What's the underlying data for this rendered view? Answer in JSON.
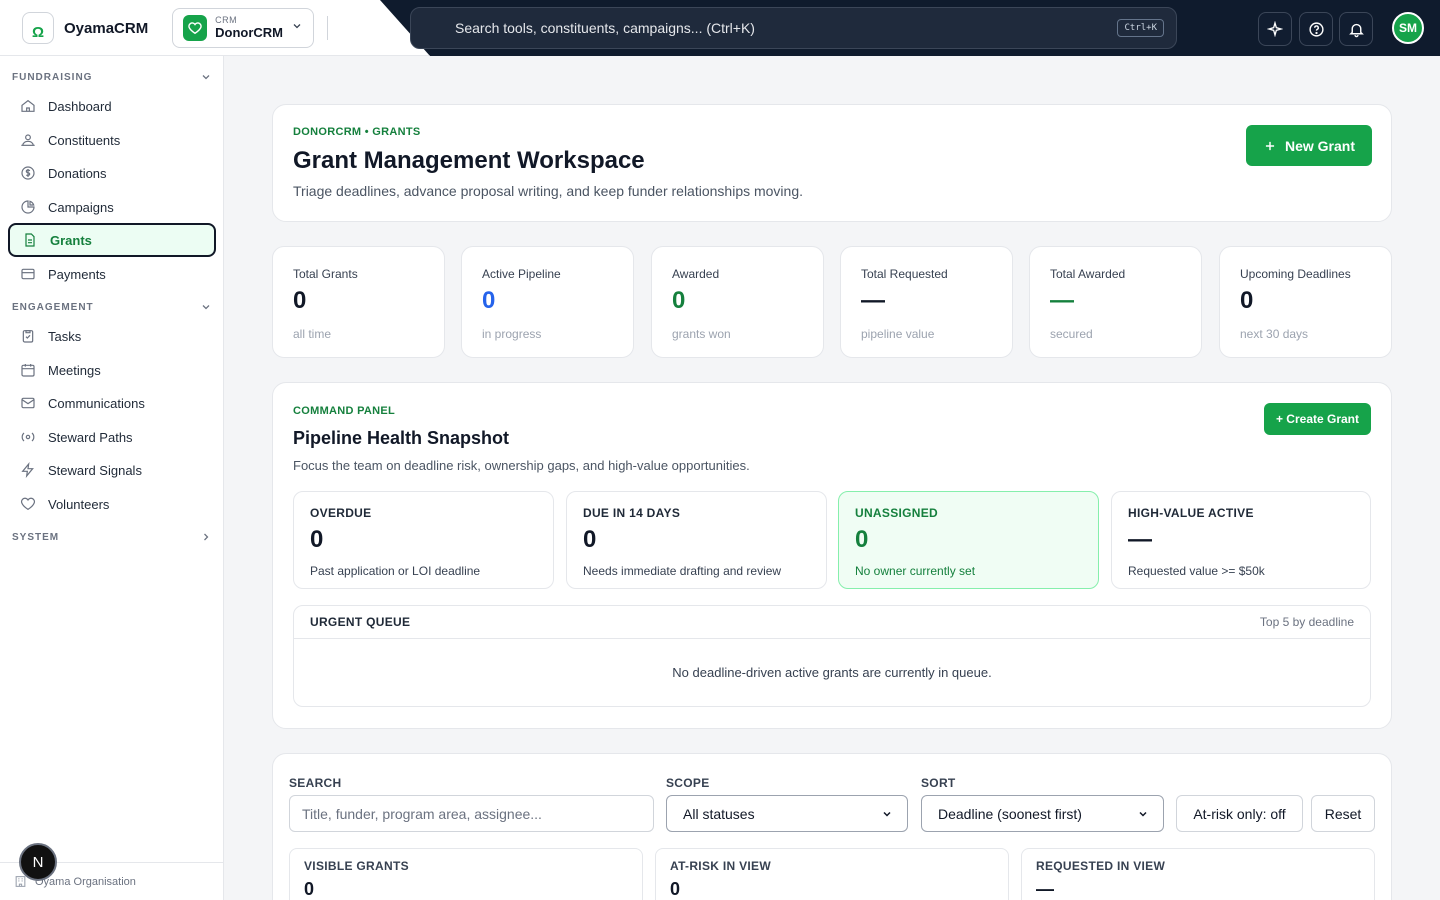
{
  "brand": {
    "name": "OyamaCRM",
    "logo_text": "Ω"
  },
  "crm_switch": {
    "small": "CRM",
    "name": "DonorCRM"
  },
  "search": {
    "text": "Search tools, constituents, campaigns... (Ctrl+K)",
    "shortcut": "Ctrl+K"
  },
  "user": {
    "initials": "SM"
  },
  "sidebar": {
    "fundraising": "FUNDRAISING",
    "engagement": "ENGAGEMENT",
    "system": "SYSTEM",
    "items": {
      "dashboard": "Dashboard",
      "constituents": "Constituents",
      "donations": "Donations",
      "campaigns": "Campaigns",
      "grants": "Grants",
      "payments": "Payments",
      "tasks": "Tasks",
      "meetings": "Meetings",
      "communications": "Communications",
      "steward_paths": "Steward Paths",
      "steward_signals": "Steward Signals",
      "volunteers": "Volunteers"
    },
    "org": "Oyama Organisation",
    "bubble": "N"
  },
  "header": {
    "eyebrow": "DONORCRM • GRANTS",
    "title": "Grant Management Workspace",
    "subtitle": "Triage deadlines, advance proposal writing, and keep funder relationships moving.",
    "new_grant": "New Grant"
  },
  "stats": [
    {
      "label": "Total Grants",
      "value": "0",
      "sub": "all time",
      "color": "#111827"
    },
    {
      "label": "Active Pipeline",
      "value": "0",
      "sub": "in progress",
      "color": "#2563eb"
    },
    {
      "label": "Awarded",
      "value": "0",
      "sub": "grants won",
      "color": "#15803d"
    },
    {
      "label": "Total Requested",
      "value": "—",
      "sub": "pipeline value",
      "color": "#111827"
    },
    {
      "label": "Total Awarded",
      "value": "—",
      "sub": "secured",
      "color": "#15803d"
    },
    {
      "label": "Upcoming Deadlines",
      "value": "0",
      "sub": "next 30 days",
      "color": "#111827"
    }
  ],
  "command": {
    "eyebrow": "COMMAND PANEL",
    "title": "Pipeline Health Snapshot",
    "subtitle": "Focus the team on deadline risk, ownership gaps, and high-value opportunities.",
    "create": "+ Create Grant",
    "cards": [
      {
        "label": "OVERDUE",
        "value": "0",
        "sub": "Past application or LOI deadline"
      },
      {
        "label": "DUE IN 14 DAYS",
        "value": "0",
        "sub": "Needs immediate drafting and review"
      },
      {
        "label": "UNASSIGNED",
        "value": "0",
        "sub": "No owner currently set"
      },
      {
        "label": "HIGH-VALUE ACTIVE",
        "value": "—",
        "sub": "Requested value >= $50k"
      }
    ],
    "queue": {
      "title": "URGENT QUEUE",
      "right": "Top 5 by deadline",
      "empty": "No deadline-driven active grants are currently in queue."
    }
  },
  "filters": {
    "search_label": "SEARCH",
    "search_placeholder": "Title, funder, program area, assignee...",
    "scope_label": "SCOPE",
    "scope_value": "All statuses",
    "sort_label": "SORT",
    "sort_value": "Deadline (soonest first)",
    "at_risk": "At-risk only: off",
    "reset": "Reset",
    "summary": [
      {
        "label": "VISIBLE GRANTS",
        "value": "0"
      },
      {
        "label": "AT-RISK IN VIEW",
        "value": "0"
      },
      {
        "label": "REQUESTED IN VIEW",
        "value": "—"
      }
    ]
  }
}
